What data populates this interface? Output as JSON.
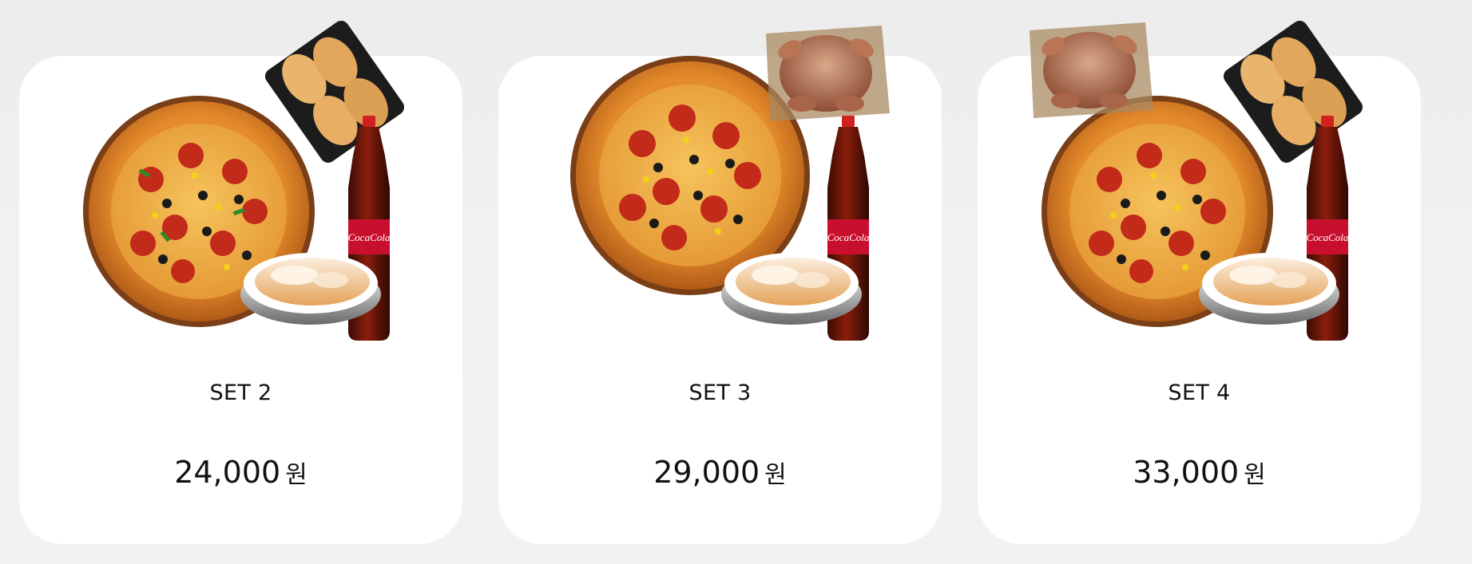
{
  "cards": [
    {
      "name": "SET 2",
      "price": "24,000",
      "currency": "원",
      "items": [
        "pizza",
        "wings",
        "cola",
        "pasta"
      ]
    },
    {
      "name": "SET 3",
      "price": "29,000",
      "currency": "원",
      "items": [
        "pizza",
        "roast-chicken",
        "cola",
        "pasta"
      ]
    },
    {
      "name": "SET 4",
      "price": "33,000",
      "currency": "원",
      "items": [
        "pizza",
        "roast-chicken",
        "wings",
        "cola",
        "pasta"
      ]
    }
  ],
  "colors": {
    "background": "#efefef",
    "card": "#ffffff",
    "text": "#111111",
    "cola_red": "#c8102e"
  }
}
